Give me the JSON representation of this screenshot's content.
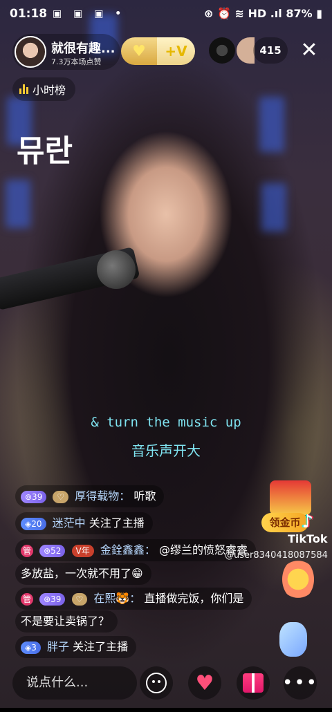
{
  "status_bar": {
    "time": "01:18",
    "icons": "▣ ▣ ▣ •",
    "right": "⊛ ⏰ ≋ HD .ıl 87% ▮",
    "battery": "87%"
  },
  "host": {
    "name": "就很有趣...",
    "likes": "7.3万本场点赞"
  },
  "top_badges": {
    "gold_icon": "♥",
    "plus_label": "+V"
  },
  "viewer_count": "415",
  "close_label": "✕",
  "hour_rank_label": "小时榜",
  "overlay_text": "뮤란",
  "lyrics": {
    "english": "& turn the music up",
    "chinese": "音乐声开大"
  },
  "chat": [
    {
      "badges": [
        {
          "type": "lvl",
          "text": "⊚39"
        },
        {
          "type": "fan",
          "text": "♡"
        }
      ],
      "user": "厚得载物：",
      "text": "听歌"
    },
    {
      "badges": [
        {
          "type": "blue",
          "text": "◈20"
        }
      ],
      "user": "迷茫中",
      "text": "关注了主播"
    },
    {
      "badges": [
        {
          "type": "mgr",
          "text": "管"
        },
        {
          "type": "lvl",
          "text": "⊛52"
        },
        {
          "type": "year",
          "text": "V年"
        }
      ],
      "user": "金銓鑫鑫：",
      "text": "@缪兰的愤怒睿睿"
    },
    {
      "badges": [],
      "user": "",
      "text": "多放盐，一次就不用了😁"
    },
    {
      "badges": [
        {
          "type": "mgr",
          "text": "管"
        },
        {
          "type": "lvl",
          "text": "⊛39"
        },
        {
          "type": "fan",
          "text": "♡"
        }
      ],
      "user": "在熙🐯：",
      "text": "直播做完饭，你们是"
    },
    {
      "badges": [],
      "user": "",
      "text": "不是要让卖锅了？"
    },
    {
      "badges": [
        {
          "type": "blue",
          "text": "◈3"
        }
      ],
      "user": "胖子",
      "text": "关注了主播"
    }
  ],
  "gold_button": "领金币",
  "watermark": {
    "brand": "TikTok",
    "user": "@user8340418087584"
  },
  "bottom_bar": {
    "comment_placeholder": "说点什么...",
    "more": "•••"
  }
}
